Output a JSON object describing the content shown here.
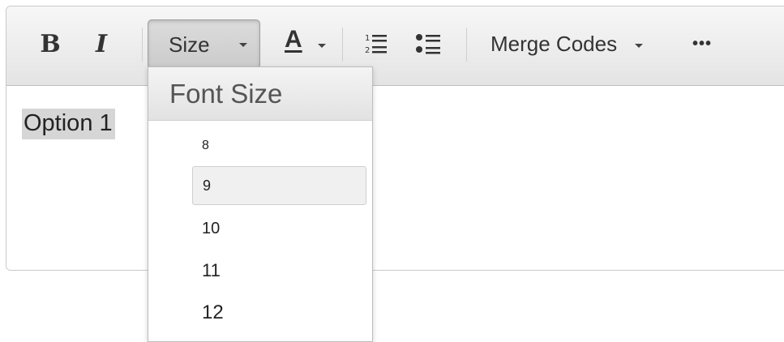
{
  "toolbar": {
    "bold_label": "B",
    "italic_label": "I",
    "size_label": "Size",
    "color_label": "A",
    "merge_codes_label": "Merge Codes",
    "more_label": "•••"
  },
  "content": {
    "text": "Option 1"
  },
  "font_size_menu": {
    "header": "Font Size",
    "items": [
      {
        "label": "8",
        "selected": false
      },
      {
        "label": "9",
        "selected": true
      },
      {
        "label": "10",
        "selected": false
      },
      {
        "label": "11",
        "selected": false
      },
      {
        "label": "12",
        "selected": false
      }
    ]
  },
  "icons": {
    "bold": "bold-icon",
    "italic": "italic-icon",
    "font_color": "font-color-icon",
    "ordered_list": "ordered-list-icon",
    "unordered_list": "unordered-list-icon",
    "more": "more-icon"
  }
}
